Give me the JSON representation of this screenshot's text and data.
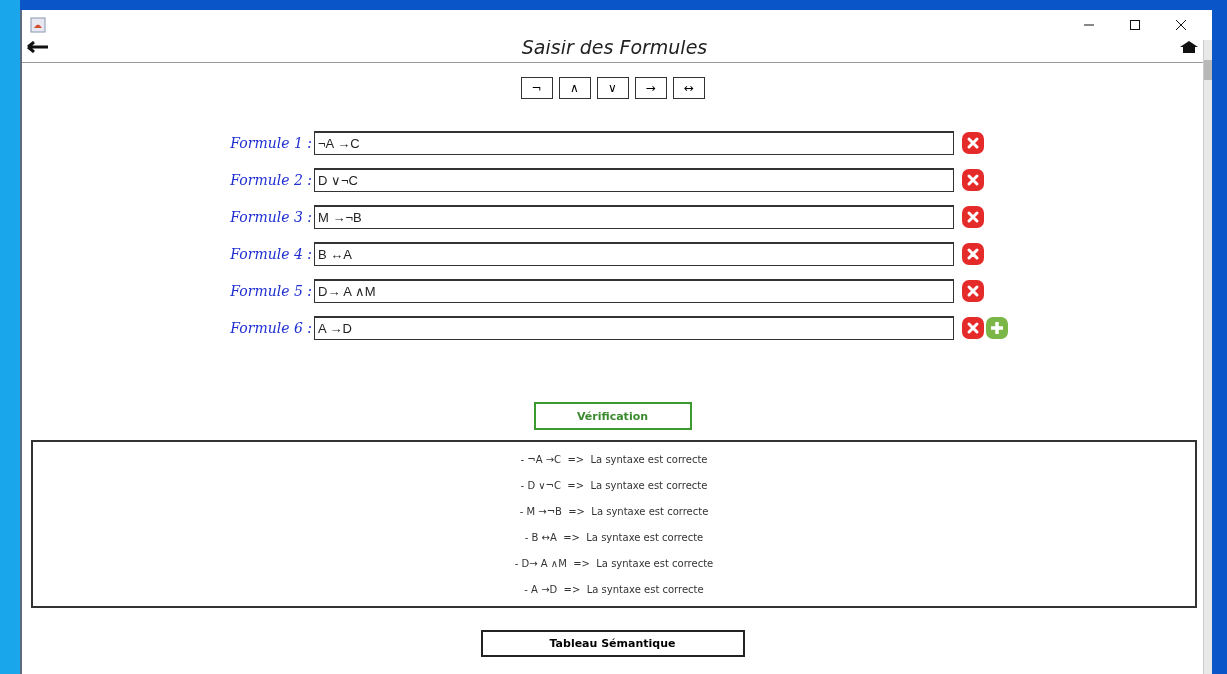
{
  "header": {
    "title": "Saisir des Formules"
  },
  "operators": [
    "¬",
    "∧",
    "∨",
    "→",
    "↔"
  ],
  "formulas": [
    {
      "label": "Formule 1 :",
      "value": "¬A →C",
      "add_button": false
    },
    {
      "label": "Formule 2 :",
      "value": "D ∨¬C",
      "add_button": false
    },
    {
      "label": "Formule 3 :",
      "value": "M →¬B",
      "add_button": false
    },
    {
      "label": "Formule 4 :",
      "value": "B ↔A",
      "add_button": false
    },
    {
      "label": "Formule 5 :",
      "value": "D→ A ∧M",
      "add_button": false
    },
    {
      "label": "Formule 6 :",
      "value": "A →D",
      "add_button": true
    }
  ],
  "verify_button": "Vérification",
  "results": [
    "- ¬A →C  =>  La syntaxe est correcte",
    "- D ∨¬C  =>  La syntaxe est correcte",
    "- M →¬B  =>  La syntaxe est correcte",
    "- B ↔A  =>  La syntaxe est correcte",
    "- D→ A ∧M  =>  La syntaxe est correcte",
    "- A →D  =>  La syntaxe est correcte"
  ],
  "tableau_button": "Tableau Sémantique"
}
